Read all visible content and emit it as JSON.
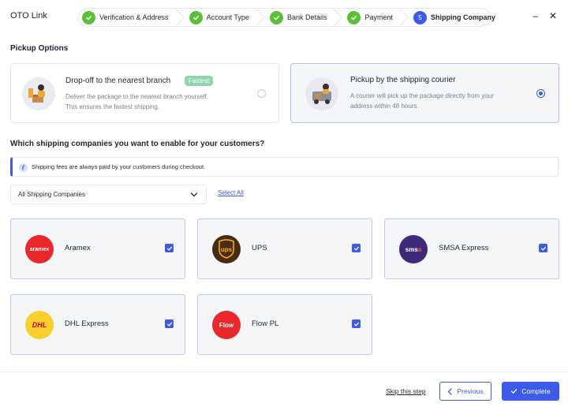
{
  "app": {
    "title": "OTO Link"
  },
  "stepper": {
    "steps": [
      {
        "label": "Verification & Address",
        "state": "done"
      },
      {
        "label": "Account Type",
        "state": "done"
      },
      {
        "label": "Bank Details",
        "state": "done"
      },
      {
        "label": "Payment",
        "state": "done"
      },
      {
        "label": "Shipping Company",
        "state": "active",
        "number": "5"
      }
    ]
  },
  "window": {
    "minimize": "–",
    "close": "✕"
  },
  "pickup": {
    "section_title": "Pickup Options",
    "options": [
      {
        "title": "Drop-off to the nearest branch",
        "badge": "Fastest",
        "desc_line1": "Deliver the package to the nearest branch yourself.",
        "desc_line2": "This ensures the fastest shipping.",
        "selected": false
      },
      {
        "title": "Pickup by the shipping courier",
        "desc_line1": "A courier will pick up the package directly from your",
        "desc_line2": "address within 48 hours.",
        "selected": true
      }
    ]
  },
  "companies_section": {
    "question": "Which shipping companies you want to enable for your customers?",
    "info": "Shipping fees are always paid by your customers during checkout.",
    "filter_value": "All Shipping Companies",
    "select_all": "Select All"
  },
  "companies": [
    {
      "name": "Aramex",
      "logo_text": "aramex",
      "logo_color": "#e8282b",
      "checked": true
    },
    {
      "name": "UPS",
      "logo_text": "ups",
      "logo_color": "#4a2a12",
      "checked": true
    },
    {
      "name": "SMSA Express",
      "logo_text": "smsa",
      "logo_color": "#3d2a7a",
      "checked": true
    },
    {
      "name": "DHL Express",
      "logo_text": "DHL",
      "logo_color": "#f9cf2e",
      "checked": true
    },
    {
      "name": "Flow PL",
      "logo_text": "Flow",
      "logo_color": "#e8282b",
      "checked": true
    }
  ],
  "footer": {
    "skip": "Skip this step",
    "previous": "Previous",
    "complete": "Complete"
  },
  "colors": {
    "accent": "#3d5ae8",
    "success": "#5cbf3a",
    "badge": "#8fd4ae"
  }
}
